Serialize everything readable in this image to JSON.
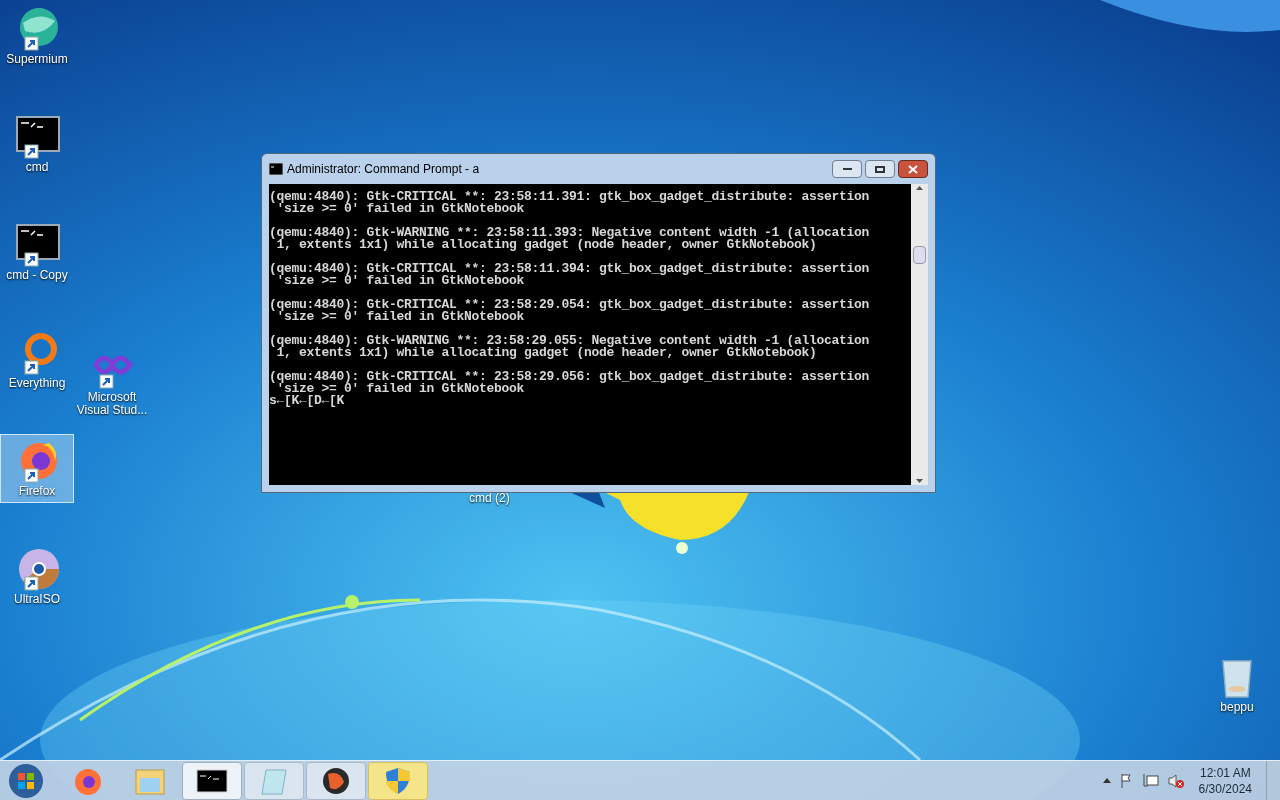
{
  "desktop_icons": [
    {
      "label": "Supermium",
      "kind": "supermium",
      "selected": false
    },
    {
      "label": "cmd",
      "kind": "console",
      "selected": false
    },
    {
      "label": "cmd - Copy",
      "kind": "console",
      "selected": false
    },
    {
      "label": "Everything",
      "kind": "everything",
      "selected": false
    },
    {
      "label": "Microsoft Visual Stud...",
      "kind": "vs",
      "selected": false
    },
    {
      "label": "Firefox",
      "kind": "firefox",
      "selected": true
    },
    {
      "label": "UltraISO",
      "kind": "disc",
      "selected": false
    },
    {
      "label": "cmd (2)",
      "kind": "hidden",
      "selected": false
    },
    {
      "label": "beppu",
      "kind": "bin",
      "selected": false
    }
  ],
  "window": {
    "title": "Administrator:  Command Prompt - a",
    "console": [
      {
        "lines": [
          "(qemu:4840): Gtk-CRITICAL **: 23:58:11.391: gtk_box_gadget_distribute: assertion",
          " 'size >= 0' failed in GtkNotebook"
        ]
      },
      {
        "lines": [
          "(qemu:4840): Gtk-WARNING **: 23:58:11.393: Negative content width -1 (allocation",
          " 1, extents 1x1) while allocating gadget (node header, owner GtkNotebook)"
        ]
      },
      {
        "lines": [
          "(qemu:4840): Gtk-CRITICAL **: 23:58:11.394: gtk_box_gadget_distribute: assertion",
          " 'size >= 0' failed in GtkNotebook"
        ]
      },
      {
        "lines": [
          "(qemu:4840): Gtk-CRITICAL **: 23:58:29.054: gtk_box_gadget_distribute: assertion",
          " 'size >= 0' failed in GtkNotebook"
        ]
      },
      {
        "lines": [
          "(qemu:4840): Gtk-WARNING **: 23:58:29.055: Negative content width -1 (allocation",
          " 1, extents 1x1) while allocating gadget (node header, owner GtkNotebook)"
        ]
      },
      {
        "lines": [
          "(qemu:4840): Gtk-CRITICAL **: 23:58:29.056: gtk_box_gadget_distribute: assertion",
          " 'size >= 0' failed in GtkNotebook",
          "s←[K←[D←[K"
        ]
      }
    ]
  },
  "taskbar": {
    "items": [
      {
        "kind": "firefox",
        "selected": false
      },
      {
        "kind": "explorer",
        "selected": false
      },
      {
        "kind": "console",
        "selected": true
      },
      {
        "kind": "notepad",
        "selected": false
      },
      {
        "kind": "qemu",
        "selected": false
      },
      {
        "kind": "shield",
        "selected": false
      }
    ],
    "clock": {
      "time": "12:01 AM",
      "date": "6/30/2024"
    }
  }
}
